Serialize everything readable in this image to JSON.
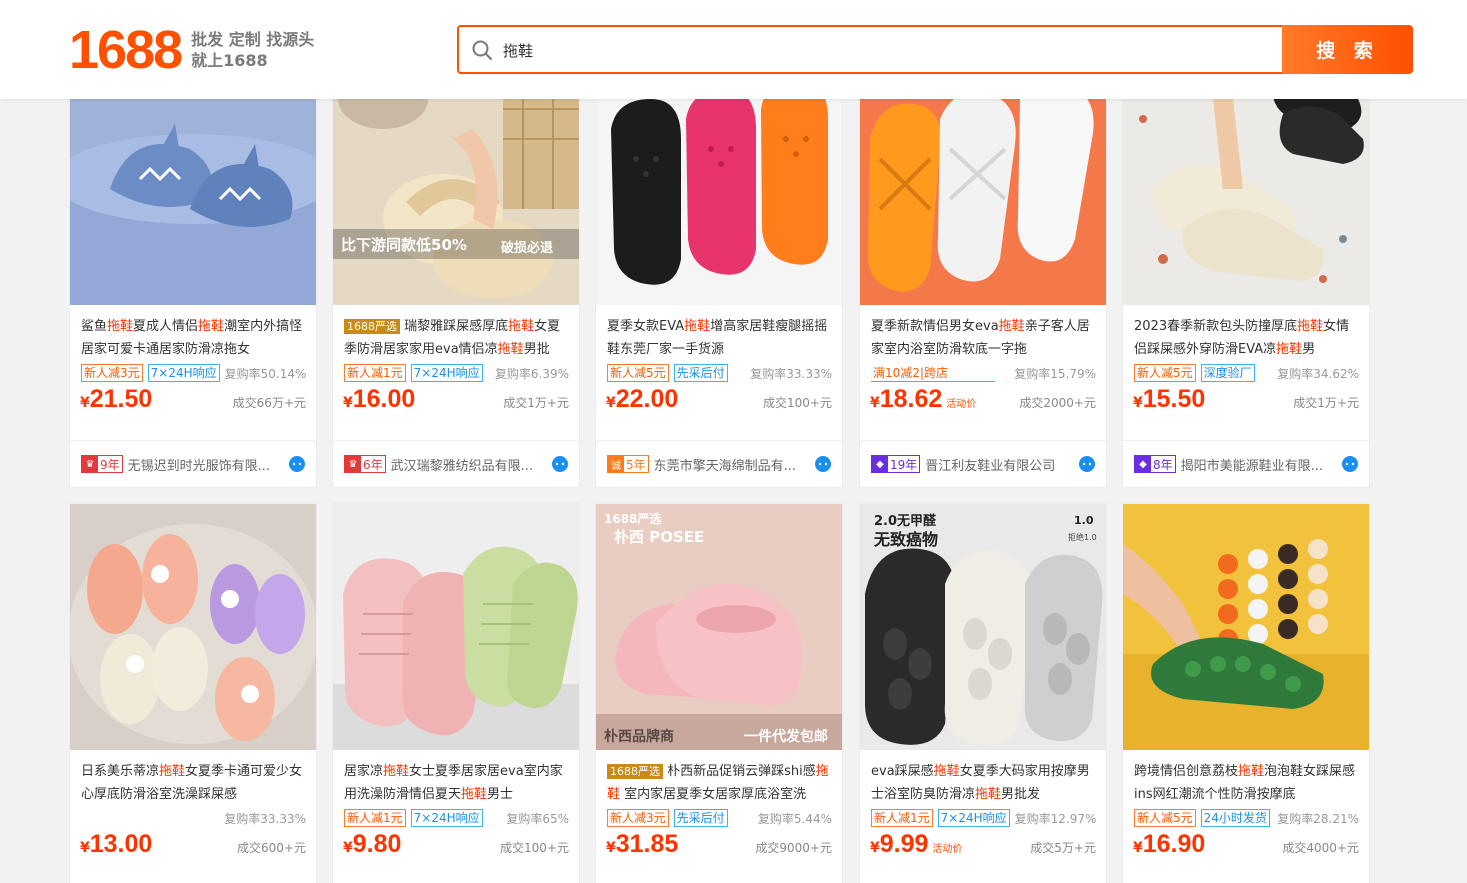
{
  "header": {
    "logo_text": "1688",
    "slogan_line1": "批发 定制 找源头",
    "slogan_line2": "就上1688",
    "search_value": "拖鞋",
    "search_button": "搜 索"
  },
  "products": [
    {
      "title_parts": [
        "鲨鱼",
        "拖鞋",
        "夏成人情侣",
        "拖鞋",
        "潮室内外搞怪居家可爱卡通居家防滑凉拖女"
      ],
      "tags": [
        {
          "text": "新人减3元",
          "style": "orange"
        },
        {
          "text": "7×24H响应",
          "style": "blue"
        }
      ],
      "repurchase": "复购率50.14%",
      "price": "21.50",
      "price_note": "",
      "deals": "成交66万+元",
      "supplier_years": "9年",
      "supplier_badge": "red",
      "supplier_name": "无锡迟到时光服饰有限...",
      "image_overlay": []
    },
    {
      "title_prefix": "1688严选",
      "title_parts": [
        " 瑞黎雅踩屎感厚底",
        "拖鞋",
        "女夏季防滑居家家用eva情侣凉",
        "拖鞋",
        "男批"
      ],
      "tags": [
        {
          "text": "新人减1元",
          "style": "orange"
        },
        {
          "text": "7×24H响应",
          "style": "blue"
        }
      ],
      "repurchase": "复购率6.39%",
      "price": "16.00",
      "price_note": "",
      "deals": "成交1万+元",
      "supplier_years": "6年",
      "supplier_badge": "red",
      "supplier_name": "武汉瑞黎雅纺织品有限...",
      "image_overlay": [
        "比下游同款低50%",
        "破损必退"
      ]
    },
    {
      "title_parts": [
        "夏季女款EVA",
        "拖鞋",
        "增高家居鞋瘦腿摇摇鞋东莞厂家一手货源"
      ],
      "tags": [
        {
          "text": "新人减5元",
          "style": "orange"
        },
        {
          "text": "先采后付",
          "style": "blue"
        }
      ],
      "repurchase": "复购率33.33%",
      "price": "22.00",
      "price_note": "",
      "deals": "成交100+元",
      "supplier_years": "5年",
      "supplier_badge": "orange",
      "supplier_name": "东莞市擎天海绵制品有...",
      "image_overlay": []
    },
    {
      "title_parts": [
        "夏季新款情侣男女eva",
        "拖鞋",
        "亲子客人居家室内浴室防滑软底一字拖"
      ],
      "tags": [
        {
          "text": "满10减2|跨店",
          "style": "orange"
        }
      ],
      "repurchase": "复购率15.79%",
      "price": "18.62",
      "price_note": "活动价",
      "deals": "成交2000+元",
      "supplier_years": "19年",
      "supplier_badge": "purple",
      "supplier_name": "晋江利友鞋业有限公司",
      "image_overlay": []
    },
    {
      "title_parts": [
        "2023春季新款包头防撞厚底",
        "拖鞋",
        "女情侣踩屎感外穿防滑EVA凉",
        "拖鞋",
        "男"
      ],
      "tags": [
        {
          "text": "新人减5元",
          "style": "orange"
        },
        {
          "text": "深度验厂",
          "style": "blue"
        }
      ],
      "repurchase": "复购率34.62%",
      "price": "15.50",
      "price_note": "",
      "deals": "成交1万+元",
      "supplier_years": "8年",
      "supplier_badge": "purple",
      "supplier_name": "揭阳市美能源鞋业有限...",
      "image_overlay": []
    },
    {
      "title_parts": [
        "日系美乐蒂凉",
        "拖鞋",
        "女夏季卡通可爱少女心厚底防滑浴室洗澡踩屎感"
      ],
      "tags": [],
      "repurchase": "复购率33.33%",
      "price": "13.00",
      "price_note": "",
      "deals": "成交600+元",
      "image_overlay": []
    },
    {
      "title_parts": [
        "居家凉",
        "拖鞋",
        "女士夏季居家居eva室内家用洗澡防滑情侣夏天",
        "拖鞋",
        "男士"
      ],
      "tags": [
        {
          "text": "新人减1元",
          "style": "orange"
        },
        {
          "text": "7×24H响应",
          "style": "blue"
        }
      ],
      "repurchase": "复购率65%",
      "price": "9.80",
      "price_note": "",
      "deals": "成交100+元",
      "image_overlay": []
    },
    {
      "title_prefix": "1688严选",
      "title_parts": [
        " 朴西新品促销云弹踩shi感",
        "拖鞋",
        " 室内家居夏季女居家厚底浴室洗"
      ],
      "tags": [
        {
          "text": "新人减3元",
          "style": "orange"
        },
        {
          "text": "先采后付",
          "style": "blue"
        }
      ],
      "repurchase": "复购率5.44%",
      "price": "31.85",
      "price_note": "",
      "deals": "成交9000+元",
      "image_overlay": [
        "1688严选",
        "朴西 POSEE",
        "朴西品牌商",
        "一件代发包邮"
      ]
    },
    {
      "title_parts": [
        "eva踩屎感",
        "拖鞋",
        "女夏季大码家用按摩男士浴室防臭防滑凉",
        "拖鞋",
        "男批发"
      ],
      "tags": [
        {
          "text": "新人减1元",
          "style": "orange"
        },
        {
          "text": "7×24H响应",
          "style": "blue"
        }
      ],
      "repurchase": "复购率12.97%",
      "price": "9.99",
      "price_note": "活动价",
      "deals": "成交5万+元",
      "image_overlay": [
        "2.0无甲醛",
        "无致癌物",
        "1.0",
        "拒绝1.0"
      ]
    },
    {
      "title_parts": [
        "跨境情侣创意荔枝",
        "拖鞋",
        "泡泡鞋女踩屎感ins网红潮流个性防滑按摩底"
      ],
      "tags": [
        {
          "text": "新人减5元",
          "style": "orange"
        },
        {
          "text": "24小时发货",
          "style": "blue"
        }
      ],
      "repurchase": "复购率28.21%",
      "price": "16.90",
      "price_note": "",
      "deals": "成交4000+元",
      "image_overlay": []
    }
  ],
  "currency_symbol": "¥",
  "colors": {
    "brand": "#ff5000",
    "highlight": "#ff3300",
    "blue_tag": "#1a8ff2"
  }
}
